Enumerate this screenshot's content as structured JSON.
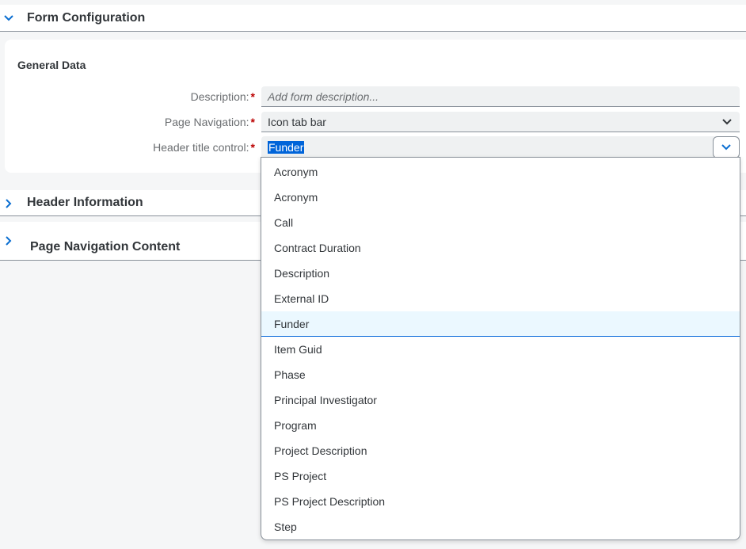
{
  "form_config": {
    "title": "Form Configuration",
    "icon": "chevron-down-icon"
  },
  "general_data": {
    "title": "General Data",
    "description": {
      "label": "Description:",
      "required_mark": "*",
      "placeholder": "Add form description..."
    },
    "page_navigation": {
      "label": "Page Navigation:",
      "required_mark": "*",
      "value": "Icon tab bar"
    },
    "header_title_control": {
      "label": "Header title control:",
      "required_mark": "*",
      "value": "Funder"
    }
  },
  "header_information": {
    "title": "Header Information",
    "icon": "chevron-right-icon"
  },
  "page_navigation_content": {
    "title": "Page Navigation Content",
    "icon": "chevron-right-icon"
  },
  "dropdown": {
    "options": [
      "Acronym",
      "Acronym",
      "Call",
      "Contract Duration",
      "Description",
      "External ID",
      "Funder",
      "Item Guid",
      "Phase",
      "Principal Investigator",
      "Program",
      "Project Description",
      "PS Project",
      "PS Project Description",
      "Step"
    ],
    "selected_index": 6
  },
  "colors": {
    "accent": "#0a6ed1",
    "required": "#bb0000",
    "selection": "#0064d9",
    "option_selected_bg": "#ebf8ff"
  }
}
